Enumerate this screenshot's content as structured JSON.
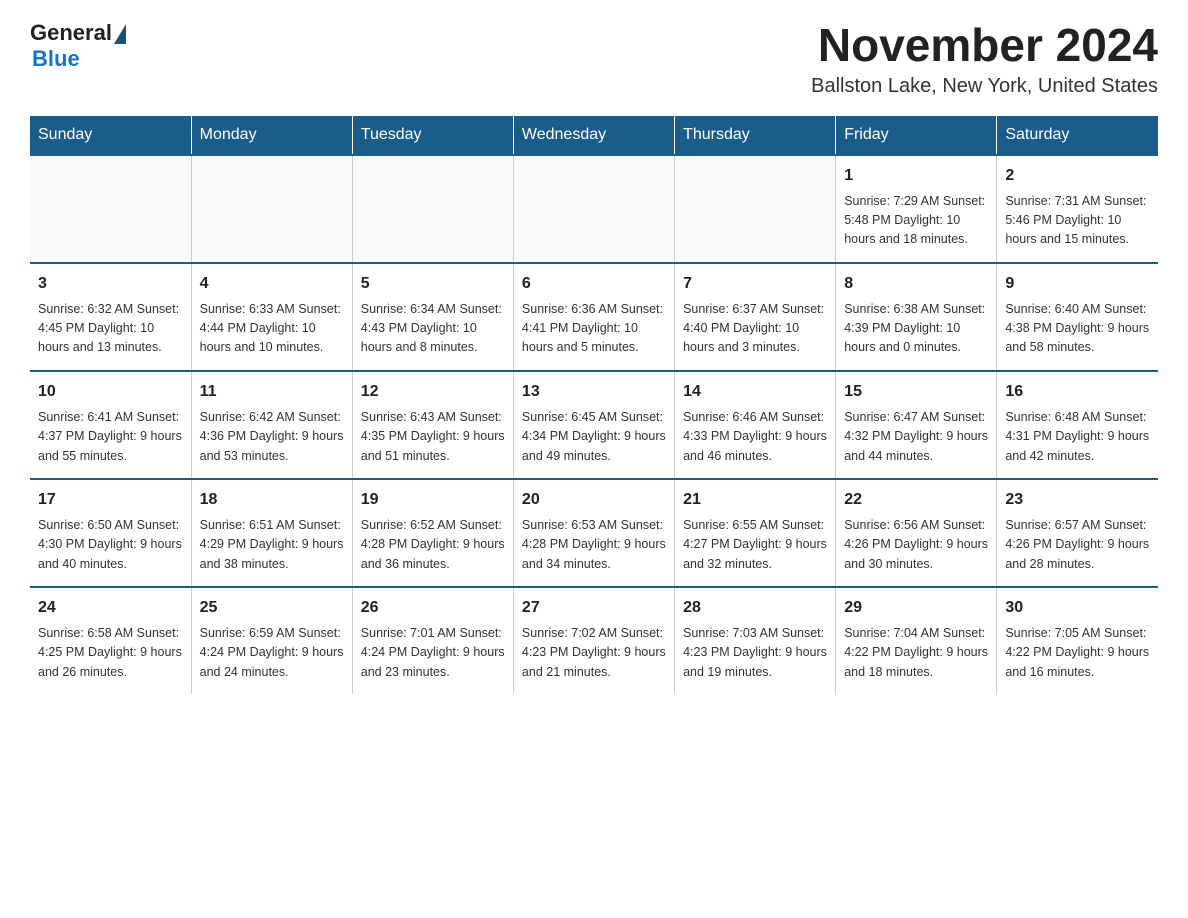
{
  "header": {
    "logo_general": "General",
    "logo_blue": "Blue",
    "month_title": "November 2024",
    "location": "Ballston Lake, New York, United States"
  },
  "days_of_week": [
    "Sunday",
    "Monday",
    "Tuesday",
    "Wednesday",
    "Thursday",
    "Friday",
    "Saturday"
  ],
  "weeks": [
    [
      {
        "day": "",
        "info": ""
      },
      {
        "day": "",
        "info": ""
      },
      {
        "day": "",
        "info": ""
      },
      {
        "day": "",
        "info": ""
      },
      {
        "day": "",
        "info": ""
      },
      {
        "day": "1",
        "info": "Sunrise: 7:29 AM\nSunset: 5:48 PM\nDaylight: 10 hours\nand 18 minutes."
      },
      {
        "day": "2",
        "info": "Sunrise: 7:31 AM\nSunset: 5:46 PM\nDaylight: 10 hours\nand 15 minutes."
      }
    ],
    [
      {
        "day": "3",
        "info": "Sunrise: 6:32 AM\nSunset: 4:45 PM\nDaylight: 10 hours\nand 13 minutes."
      },
      {
        "day": "4",
        "info": "Sunrise: 6:33 AM\nSunset: 4:44 PM\nDaylight: 10 hours\nand 10 minutes."
      },
      {
        "day": "5",
        "info": "Sunrise: 6:34 AM\nSunset: 4:43 PM\nDaylight: 10 hours\nand 8 minutes."
      },
      {
        "day": "6",
        "info": "Sunrise: 6:36 AM\nSunset: 4:41 PM\nDaylight: 10 hours\nand 5 minutes."
      },
      {
        "day": "7",
        "info": "Sunrise: 6:37 AM\nSunset: 4:40 PM\nDaylight: 10 hours\nand 3 minutes."
      },
      {
        "day": "8",
        "info": "Sunrise: 6:38 AM\nSunset: 4:39 PM\nDaylight: 10 hours\nand 0 minutes."
      },
      {
        "day": "9",
        "info": "Sunrise: 6:40 AM\nSunset: 4:38 PM\nDaylight: 9 hours\nand 58 minutes."
      }
    ],
    [
      {
        "day": "10",
        "info": "Sunrise: 6:41 AM\nSunset: 4:37 PM\nDaylight: 9 hours\nand 55 minutes."
      },
      {
        "day": "11",
        "info": "Sunrise: 6:42 AM\nSunset: 4:36 PM\nDaylight: 9 hours\nand 53 minutes."
      },
      {
        "day": "12",
        "info": "Sunrise: 6:43 AM\nSunset: 4:35 PM\nDaylight: 9 hours\nand 51 minutes."
      },
      {
        "day": "13",
        "info": "Sunrise: 6:45 AM\nSunset: 4:34 PM\nDaylight: 9 hours\nand 49 minutes."
      },
      {
        "day": "14",
        "info": "Sunrise: 6:46 AM\nSunset: 4:33 PM\nDaylight: 9 hours\nand 46 minutes."
      },
      {
        "day": "15",
        "info": "Sunrise: 6:47 AM\nSunset: 4:32 PM\nDaylight: 9 hours\nand 44 minutes."
      },
      {
        "day": "16",
        "info": "Sunrise: 6:48 AM\nSunset: 4:31 PM\nDaylight: 9 hours\nand 42 minutes."
      }
    ],
    [
      {
        "day": "17",
        "info": "Sunrise: 6:50 AM\nSunset: 4:30 PM\nDaylight: 9 hours\nand 40 minutes."
      },
      {
        "day": "18",
        "info": "Sunrise: 6:51 AM\nSunset: 4:29 PM\nDaylight: 9 hours\nand 38 minutes."
      },
      {
        "day": "19",
        "info": "Sunrise: 6:52 AM\nSunset: 4:28 PM\nDaylight: 9 hours\nand 36 minutes."
      },
      {
        "day": "20",
        "info": "Sunrise: 6:53 AM\nSunset: 4:28 PM\nDaylight: 9 hours\nand 34 minutes."
      },
      {
        "day": "21",
        "info": "Sunrise: 6:55 AM\nSunset: 4:27 PM\nDaylight: 9 hours\nand 32 minutes."
      },
      {
        "day": "22",
        "info": "Sunrise: 6:56 AM\nSunset: 4:26 PM\nDaylight: 9 hours\nand 30 minutes."
      },
      {
        "day": "23",
        "info": "Sunrise: 6:57 AM\nSunset: 4:26 PM\nDaylight: 9 hours\nand 28 minutes."
      }
    ],
    [
      {
        "day": "24",
        "info": "Sunrise: 6:58 AM\nSunset: 4:25 PM\nDaylight: 9 hours\nand 26 minutes."
      },
      {
        "day": "25",
        "info": "Sunrise: 6:59 AM\nSunset: 4:24 PM\nDaylight: 9 hours\nand 24 minutes."
      },
      {
        "day": "26",
        "info": "Sunrise: 7:01 AM\nSunset: 4:24 PM\nDaylight: 9 hours\nand 23 minutes."
      },
      {
        "day": "27",
        "info": "Sunrise: 7:02 AM\nSunset: 4:23 PM\nDaylight: 9 hours\nand 21 minutes."
      },
      {
        "day": "28",
        "info": "Sunrise: 7:03 AM\nSunset: 4:23 PM\nDaylight: 9 hours\nand 19 minutes."
      },
      {
        "day": "29",
        "info": "Sunrise: 7:04 AM\nSunset: 4:22 PM\nDaylight: 9 hours\nand 18 minutes."
      },
      {
        "day": "30",
        "info": "Sunrise: 7:05 AM\nSunset: 4:22 PM\nDaylight: 9 hours\nand 16 minutes."
      }
    ]
  ]
}
